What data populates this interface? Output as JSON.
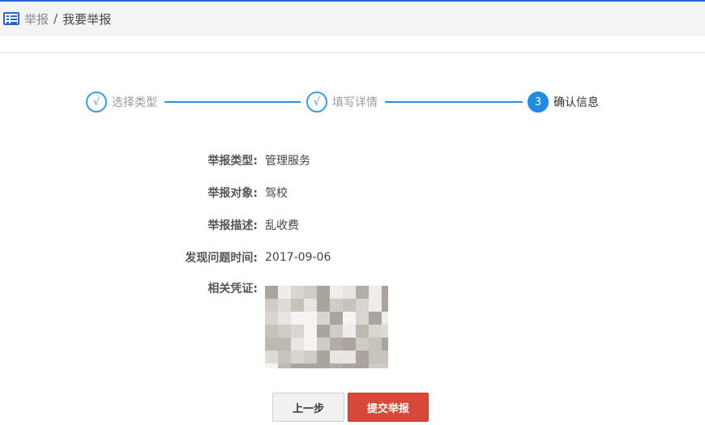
{
  "header": {
    "breadcrumb": {
      "icon": "list-icon",
      "link": "举报",
      "separator": "/",
      "current": "我要举报"
    }
  },
  "steps": [
    {
      "marker": "√",
      "label": "选择类型",
      "status": "done"
    },
    {
      "marker": "√",
      "label": "填写详情",
      "status": "done"
    },
    {
      "marker": "3",
      "label": "确认信息",
      "status": "active"
    }
  ],
  "details": {
    "type": {
      "label": "举报类型:",
      "value": "管理服务"
    },
    "target": {
      "label": "举报对象:",
      "value": "驾校"
    },
    "description": {
      "label": "举报描述:",
      "value": "乱收费"
    },
    "date": {
      "label": "发现问题时间:",
      "value": "2017-09-06"
    },
    "evidence": {
      "label": "相关凭证:"
    }
  },
  "buttons": {
    "prev": "上一步",
    "submit": "提交举报"
  },
  "colors": {
    "accent_blue": "#1e8ce6",
    "submit_red": "#d84838",
    "header_bg": "#f4f4f4"
  }
}
